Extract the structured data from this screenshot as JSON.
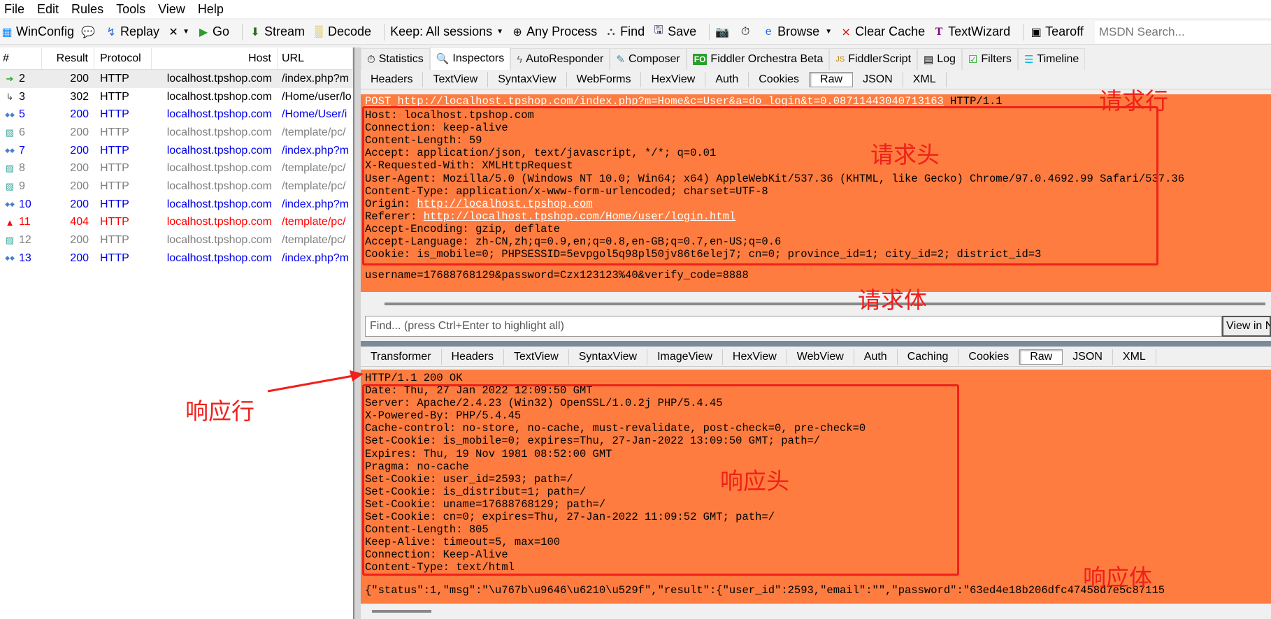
{
  "menu": [
    "File",
    "Edit",
    "Rules",
    "Tools",
    "View",
    "Help"
  ],
  "toolbar": {
    "winconfig": "WinConfig",
    "replay": "Replay",
    "go": "Go",
    "stream": "Stream",
    "decode": "Decode",
    "keep": "Keep: All sessions",
    "any_process": "Any Process",
    "find": "Find",
    "save": "Save",
    "browse": "Browse",
    "clear_cache": "Clear Cache",
    "textwizard": "TextWizard",
    "tearoff": "Tearoff",
    "msdn": "MSDN Search..."
  },
  "sessions": {
    "headers": [
      "#",
      "Result",
      "Protocol",
      "Host",
      "URL"
    ],
    "rows": [
      {
        "id": "2",
        "result": "200",
        "protocol": "HTTP",
        "host": "localhost.tpshop.com",
        "url": "/index.php?m",
        "icon": "post-arrow-icon",
        "color": "#000000"
      },
      {
        "id": "3",
        "result": "302",
        "protocol": "HTTP",
        "host": "localhost.tpshop.com",
        "url": "/Home/user/lo",
        "icon": "redirect-icon",
        "color": "#000000"
      },
      {
        "id": "5",
        "result": "200",
        "protocol": "HTTP",
        "host": "localhost.tpshop.com",
        "url": "/Home/User/i",
        "icon": "code-icon",
        "color": "#0000ee"
      },
      {
        "id": "6",
        "result": "200",
        "protocol": "HTTP",
        "host": "localhost.tpshop.com",
        "url": "/template/pc/",
        "icon": "image-icon",
        "color": "#808080"
      },
      {
        "id": "7",
        "result": "200",
        "protocol": "HTTP",
        "host": "localhost.tpshop.com",
        "url": "/index.php?m",
        "icon": "code-icon",
        "color": "#0000ee"
      },
      {
        "id": "8",
        "result": "200",
        "protocol": "HTTP",
        "host": "localhost.tpshop.com",
        "url": "/template/pc/",
        "icon": "image-icon",
        "color": "#808080"
      },
      {
        "id": "9",
        "result": "200",
        "protocol": "HTTP",
        "host": "localhost.tpshop.com",
        "url": "/template/pc/",
        "icon": "image-icon",
        "color": "#808080"
      },
      {
        "id": "10",
        "result": "200",
        "protocol": "HTTP",
        "host": "localhost.tpshop.com",
        "url": "/index.php?m",
        "icon": "code-icon",
        "color": "#0000ee"
      },
      {
        "id": "11",
        "result": "404",
        "protocol": "HTTP",
        "host": "localhost.tpshop.com",
        "url": "/template/pc/",
        "icon": "warning-icon",
        "color": "#ff0000"
      },
      {
        "id": "12",
        "result": "200",
        "protocol": "HTTP",
        "host": "localhost.tpshop.com",
        "url": "/template/pc/",
        "icon": "image-icon",
        "color": "#808080"
      },
      {
        "id": "13",
        "result": "200",
        "protocol": "HTTP",
        "host": "localhost.tpshop.com",
        "url": "/index.php?m",
        "icon": "code-icon",
        "color": "#0000ee"
      }
    ]
  },
  "tabs": [
    "Statistics",
    "Inspectors",
    "AutoResponder",
    "Composer",
    "Fiddler Orchestra Beta",
    "FiddlerScript",
    "Log",
    "Filters",
    "Timeline"
  ],
  "request_tabs": [
    "Headers",
    "TextView",
    "SyntaxView",
    "WebForms",
    "HexView",
    "Auth",
    "Cookies",
    "Raw",
    "JSON",
    "XML"
  ],
  "request": {
    "method": "POST",
    "url": "http://localhost.tpshop.com/index.php?m=Home&c=User&a=do_login&t=0.08711443040713163",
    "version": "HTTP/1.1",
    "headers_before_links": [
      "Host: localhost.tpshop.com",
      "Connection: keep-alive",
      "Content-Length: 59",
      "Accept: application/json, text/javascript, */*; q=0.01",
      "X-Requested-With: XMLHttpRequest",
      "User-Agent: Mozilla/5.0 (Windows NT 10.0; Win64; x64) AppleWebKit/537.36 (KHTML, like Gecko) Chrome/97.0.4692.99 Safari/537.36",
      "Content-Type: application/x-www-form-urlencoded; charset=UTF-8"
    ],
    "origin_label": "Origin: ",
    "origin": "http://localhost.tpshop.com",
    "referer_label": "Referer: ",
    "referer": "http://localhost.tpshop.com/Home/user/login.html",
    "headers_after_links": [
      "Accept-Encoding: gzip, deflate",
      "Accept-Language: zh-CN,zh;q=0.9,en;q=0.8,en-GB;q=0.7,en-US;q=0.6",
      "Cookie: is_mobile=0; PHPSESSID=5evpgol5q98pl50jv86t6elej7; cn=0; province_id=1; city_id=2; district_id=3"
    ],
    "body": "username=17688768129&password=Czx123123%40&verify_code=8888"
  },
  "find_placeholder": "Find... (press Ctrl+Enter to highlight all)",
  "view_in": "View in Notepad",
  "response_tabs": [
    "Transformer",
    "Headers",
    "TextView",
    "SyntaxView",
    "ImageView",
    "HexView",
    "WebView",
    "Auth",
    "Caching",
    "Cookies",
    "Raw",
    "JSON",
    "XML"
  ],
  "response": {
    "status_line": "HTTP/1.1 200 OK",
    "headers": [
      "Date: Thu, 27 Jan 2022 12:09:50 GMT",
      "Server: Apache/2.4.23 (Win32) OpenSSL/1.0.2j PHP/5.4.45",
      "X-Powered-By: PHP/5.4.45",
      "Cache-control: no-store, no-cache, must-revalidate, post-check=0, pre-check=0",
      "Set-Cookie: is_mobile=0; expires=Thu, 27-Jan-2022 13:09:50 GMT; path=/",
      "Expires: Thu, 19 Nov 1981 08:52:00 GMT",
      "Pragma: no-cache",
      "Set-Cookie: user_id=2593; path=/",
      "Set-Cookie: is_distribut=1; path=/",
      "Set-Cookie: uname=17688768129; path=/",
      "Set-Cookie: cn=0; expires=Thu, 27-Jan-2022 11:09:52 GMT; path=/",
      "Content-Length: 805",
      "Keep-Alive: timeout=5, max=100",
      "Connection: Keep-Alive",
      "Content-Type: text/html"
    ],
    "body": "{\"status\":1,\"msg\":\"\\u767b\\u9646\\u6210\\u529f\",\"result\":{\"user_id\":2593,\"email\":\"\",\"password\":\"63ed4e18b206dfc47458d7e5c87115"
  },
  "annotations": {
    "request_line": "请求行",
    "request_headers": "请求头",
    "request_body": "请求体",
    "response_line": "响应行",
    "response_headers": "响应头",
    "response_body": "响应体"
  },
  "colors": {
    "highlight": "#fe7c3f",
    "annotation": "#f0201a"
  }
}
